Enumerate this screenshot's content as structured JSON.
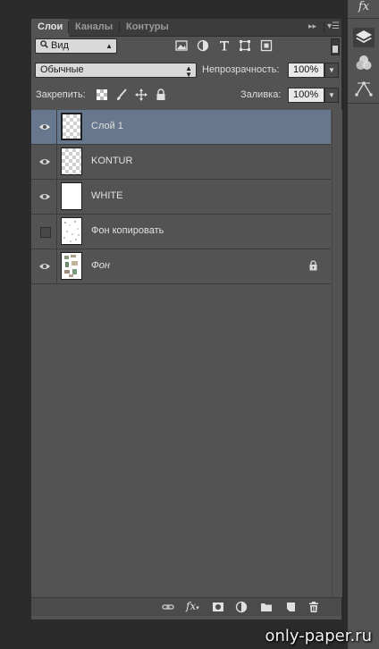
{
  "tabs": [
    {
      "label": "Слои",
      "active": true
    },
    {
      "label": "Каналы",
      "active": false
    },
    {
      "label": "Контуры",
      "active": false
    }
  ],
  "filter": {
    "label": "Вид",
    "icons": [
      "image-filter-icon",
      "adjustment-filter-icon",
      "type-filter-icon",
      "shape-filter-icon",
      "smart-object-filter-icon"
    ]
  },
  "blend_mode": "Обычные",
  "opacity": {
    "label": "Непрозрачность:",
    "value": "100%"
  },
  "lock": {
    "label": "Закрепить:",
    "icons": [
      "lock-transparent-icon",
      "lock-image-icon",
      "lock-position-icon",
      "lock-all-icon"
    ]
  },
  "fill": {
    "label": "Заливка:",
    "value": "100%"
  },
  "layers": [
    {
      "name": "Слой 1",
      "visible": true,
      "selected": true,
      "thumb": "transparent",
      "locked": false,
      "italic": false
    },
    {
      "name": "KONTUR",
      "visible": true,
      "selected": false,
      "thumb": "transparent",
      "locked": false,
      "italic": false
    },
    {
      "name": "WHITE",
      "visible": true,
      "selected": false,
      "thumb": "white",
      "locked": false,
      "italic": false
    },
    {
      "name": "Фон копировать",
      "visible": false,
      "selected": false,
      "thumb": "white-speckled",
      "locked": false,
      "italic": false
    },
    {
      "name": "Фон",
      "visible": true,
      "selected": false,
      "thumb": "image",
      "locked": true,
      "italic": true
    }
  ],
  "bottom_icons": [
    "link-layers-icon",
    "fx-icon",
    "add-mask-icon",
    "new-adjustment-icon",
    "new-group-icon",
    "new-layer-icon",
    "delete-layer-icon"
  ],
  "dock_icons": [
    "fx-styles-icon",
    "layers-panel-icon",
    "channels-panel-icon",
    "paths-panel-icon"
  ],
  "watermark": "only-paper.ru",
  "colors": {
    "selected_row": "#67778d",
    "panel": "#535353"
  }
}
